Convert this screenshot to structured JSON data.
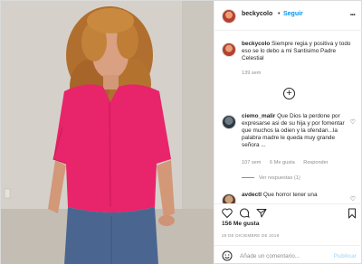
{
  "header": {
    "username": "beckycolo",
    "separator": "•",
    "follow_label": "Seguir",
    "more_label": "..."
  },
  "caption": {
    "username": "beckycolo",
    "text": "Siempre regia y positiva y todo eso se lo debo a mi Santisimo Padre Celestial",
    "time": "139 sem"
  },
  "comments": [
    {
      "username": "ciemo_malir",
      "text": "Que Dios la perdone por expresarse asi de su hija y por fomentar que muchos la odien y la ofendan...la palabra madre le queda muy grande señora ...",
      "time": "107 sem",
      "likes": "6 Me gusta",
      "reply_label": "Responder",
      "view_replies": "Ver respuestas (1)"
    },
    {
      "username": "avdectl",
      "text": "Que horror tener una"
    }
  ],
  "actions": {
    "likes": "156 Me gusta",
    "date": "29 DE DICIEMBRE DE 2018"
  },
  "add_comment": {
    "placeholder": "Añade un comentario...",
    "post_label": "Publicar"
  },
  "colors": {
    "accent": "#0095f6",
    "shirt": "#e8246a",
    "muted": "#8e8e8e"
  }
}
